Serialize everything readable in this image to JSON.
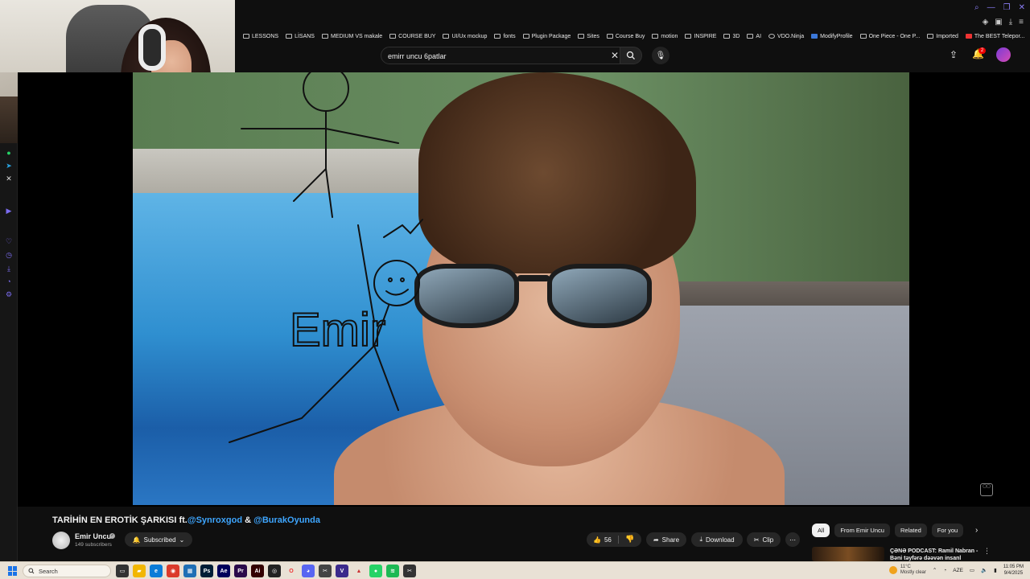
{
  "browser": {
    "bookmarks": [
      {
        "label": "LESSONS",
        "icon": "folder-icon"
      },
      {
        "label": "LİSANS",
        "icon": "folder-icon"
      },
      {
        "label": "MEDIUM VS makale",
        "icon": "folder-icon"
      },
      {
        "label": "COURSE BUY",
        "icon": "folder-icon"
      },
      {
        "label": "UI/Ux mockup",
        "icon": "folder-icon"
      },
      {
        "label": "fonts",
        "icon": "folder-icon"
      },
      {
        "label": "Plugin Package",
        "icon": "folder-icon"
      },
      {
        "label": "Sites",
        "icon": "folder-icon"
      },
      {
        "label": "Course Buy",
        "icon": "folder-icon"
      },
      {
        "label": "motion",
        "icon": "folder-icon"
      },
      {
        "label": "INSPIRE",
        "icon": "folder-icon"
      },
      {
        "label": "3D",
        "icon": "folder-icon"
      },
      {
        "label": "AI",
        "icon": "folder-icon"
      },
      {
        "label": "VDO.Ninja",
        "icon": "ninja-icon"
      },
      {
        "label": "ModifyProfile",
        "icon": "page-icon"
      },
      {
        "label": "One Piece - One P...",
        "icon": "page-icon"
      },
      {
        "label": "Imported",
        "icon": "folder-icon"
      },
      {
        "label": "The BEST Telepor...",
        "icon": "youtube-icon"
      }
    ]
  },
  "youtube": {
    "search": {
      "value": "emirr uncu 6patlar"
    },
    "notifications_count": "2",
    "video": {
      "title_prefix": "TARİHİN EN EROTİK ŞARKISI ft.",
      "mention_1": "@Synroxgod",
      "title_and": " & ",
      "mention_2": "@BurakOyunda",
      "doodle_text": "Emir"
    },
    "channel": {
      "name": "Emir Uncu",
      "subscribers": "149 subscribers",
      "subscribe_label": "Subscribed"
    },
    "actions": {
      "likes": "56",
      "share": "Share",
      "download": "Download",
      "clip": "Clip"
    },
    "chips": [
      {
        "label": "All",
        "active": true
      },
      {
        "label": "From Emir Uncu",
        "active": false
      },
      {
        "label": "Related",
        "active": false
      },
      {
        "label": "For you",
        "active": false
      }
    ],
    "recommendation": {
      "title": "ÇƏNƏ PODCAST: Ramil Nabran - Bəni təyfərə dəəvən insanl"
    }
  },
  "taskbar": {
    "search_placeholder": "Search",
    "weather_temp": "11°C",
    "weather_desc": "Mostly clear",
    "lang": "AZE",
    "time": "11:05 PM",
    "date": "9/4/2025"
  },
  "colors": {
    "accent": "#3ea6ff",
    "background": "#0f0f0f",
    "pill": "#272727",
    "badge": "#e00000"
  }
}
